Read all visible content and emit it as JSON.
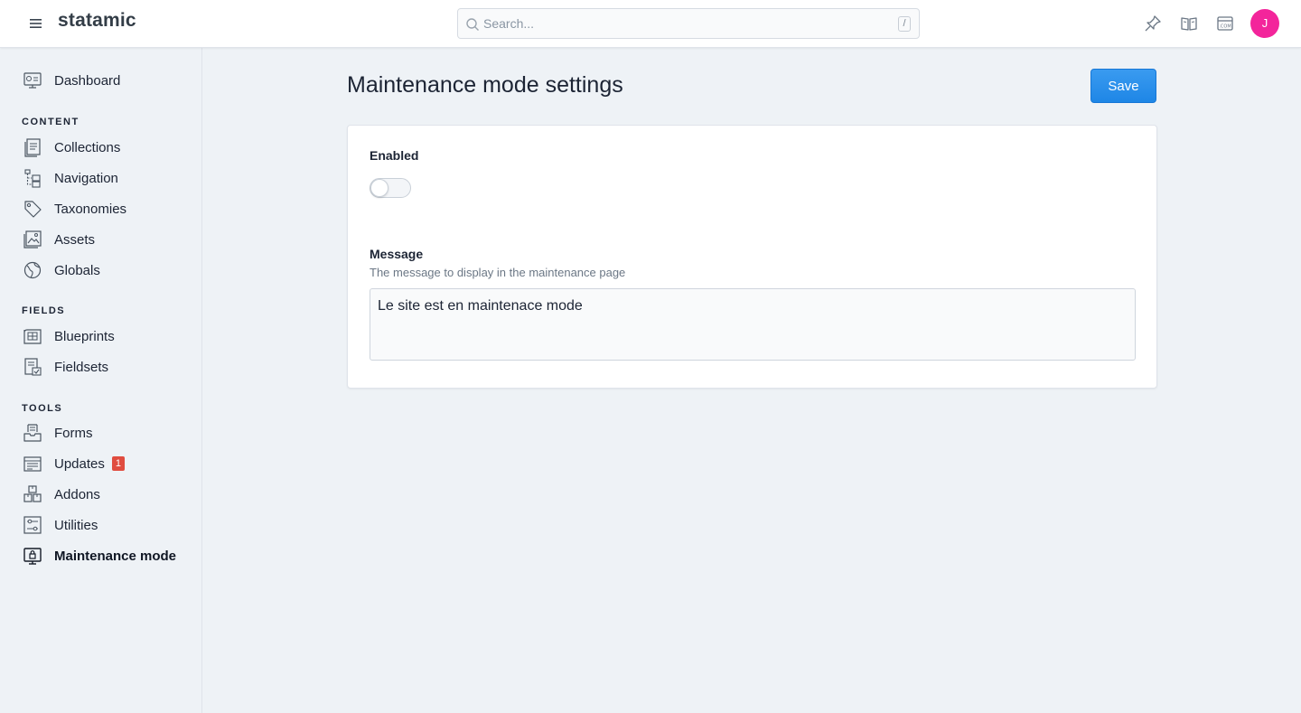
{
  "app": {
    "brand": "statamic"
  },
  "search": {
    "placeholder": "Search...",
    "shortcut": "/"
  },
  "header_icons": [
    "pin-icon",
    "docs-book-icon",
    "dotcom-icon"
  ],
  "user": {
    "initial": "J",
    "avatar_color": "#f3259b"
  },
  "sidebar": {
    "top": [
      {
        "label": "Dashboard",
        "icon": "dashboard-icon"
      }
    ],
    "sections": [
      {
        "title": "CONTENT",
        "items": [
          {
            "label": "Collections",
            "icon": "collections-icon"
          },
          {
            "label": "Navigation",
            "icon": "navigation-icon"
          },
          {
            "label": "Taxonomies",
            "icon": "tag-icon"
          },
          {
            "label": "Assets",
            "icon": "assets-icon"
          },
          {
            "label": "Globals",
            "icon": "globe-icon"
          }
        ]
      },
      {
        "title": "FIELDS",
        "items": [
          {
            "label": "Blueprints",
            "icon": "blueprints-icon"
          },
          {
            "label": "Fieldsets",
            "icon": "fieldsets-icon"
          }
        ]
      },
      {
        "title": "TOOLS",
        "items": [
          {
            "label": "Forms",
            "icon": "forms-icon"
          },
          {
            "label": "Updates",
            "icon": "updates-icon",
            "badge": "1"
          },
          {
            "label": "Addons",
            "icon": "addons-icon"
          },
          {
            "label": "Utilities",
            "icon": "utilities-icon"
          },
          {
            "label": "Maintenance mode",
            "icon": "maintenance-icon",
            "active": true
          }
        ]
      }
    ]
  },
  "main": {
    "title": "Maintenance mode settings",
    "save_label": "Save",
    "fields": {
      "enabled": {
        "label": "Enabled",
        "value": false
      },
      "message": {
        "label": "Message",
        "help": "The message to display in the maintenance page",
        "value": "Le site est en maintenace mode"
      }
    }
  },
  "colors": {
    "accent": "#1e86e6",
    "badge": "#e04c3f",
    "background": "#eef2f6"
  }
}
